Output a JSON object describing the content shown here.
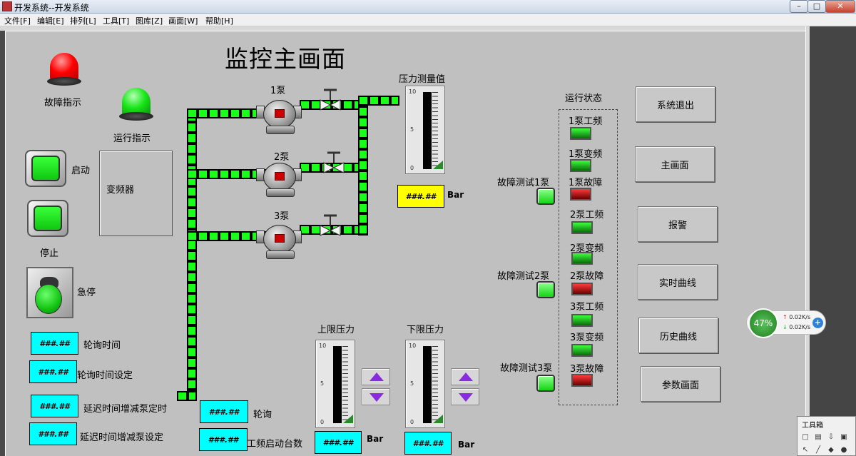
{
  "window": {
    "title": "开发系统--开发系统",
    "min_glyph": "–",
    "max_glyph": "□",
    "close_glyph": "✕"
  },
  "menu": [
    "文件[F]",
    "编辑[E]",
    "排列[L]",
    "工具[T]",
    "图库[Z]",
    "画面[W]",
    "帮助[H]"
  ],
  "screen": {
    "title": "监控主画面",
    "fault_indicator_label": "故障指示",
    "run_indicator_label": "运行指示",
    "start_label": "启动",
    "stop_label": "停止",
    "estop_label": "急停",
    "vfd_label": "变频器",
    "pump1_label": "1泵",
    "pump2_label": "2泵",
    "pump3_label": "3泵",
    "pressure_label": "压力测量值",
    "pressure_value": "###.##",
    "pressure_unit": "Bar",
    "upper_pressure_label": "上限压力",
    "lower_pressure_label": "下限压力",
    "upper_value": "###.##",
    "upper_unit": "Bar",
    "lower_value": "###.##",
    "lower_unit": "Bar",
    "gauge_ticks": [
      "10",
      "5",
      "0"
    ]
  },
  "params": [
    {
      "value": "###.##",
      "label": "轮询时间"
    },
    {
      "value": "###.##",
      "label": "轮询时间设定"
    },
    {
      "value": "###.##",
      "label": "延迟时间增减泵定时"
    },
    {
      "value": "###.##",
      "label": "延迟时间增减泵设定"
    },
    {
      "value": "###.##",
      "label": "轮询"
    },
    {
      "value": "###.##",
      "label": "工频启动台数"
    }
  ],
  "status": {
    "title": "运行状态",
    "items": [
      {
        "label": "1泵工频",
        "state": "green"
      },
      {
        "label": "1泵变频",
        "state": "green"
      },
      {
        "label": "1泵故障",
        "state": "red"
      },
      {
        "label": "2泵工频",
        "state": "green"
      },
      {
        "label": "2泵变频",
        "state": "green"
      },
      {
        "label": "2泵故障",
        "state": "red"
      },
      {
        "label": "3泵工频",
        "state": "green"
      },
      {
        "label": "3泵变频",
        "state": "green"
      },
      {
        "label": "3泵故障",
        "state": "red"
      }
    ],
    "tests": [
      "故障测试1泵",
      "故障测试2泵",
      "故障测试3泵"
    ]
  },
  "nav": [
    "系统退出",
    "主画面",
    "报警",
    "实时曲线",
    "历史曲线",
    "参数画面"
  ],
  "net_widget": {
    "percent": "47%",
    "up": "0.02K/s",
    "down": "0.02K/s",
    "plus": "+"
  },
  "toolbox": {
    "title": "工具箱"
  },
  "colors": {
    "pipe": "#1aff1a",
    "accent_cyan": "#00ffff",
    "accent_yellow": "#ffff00",
    "arrow": "#8a2be2"
  }
}
